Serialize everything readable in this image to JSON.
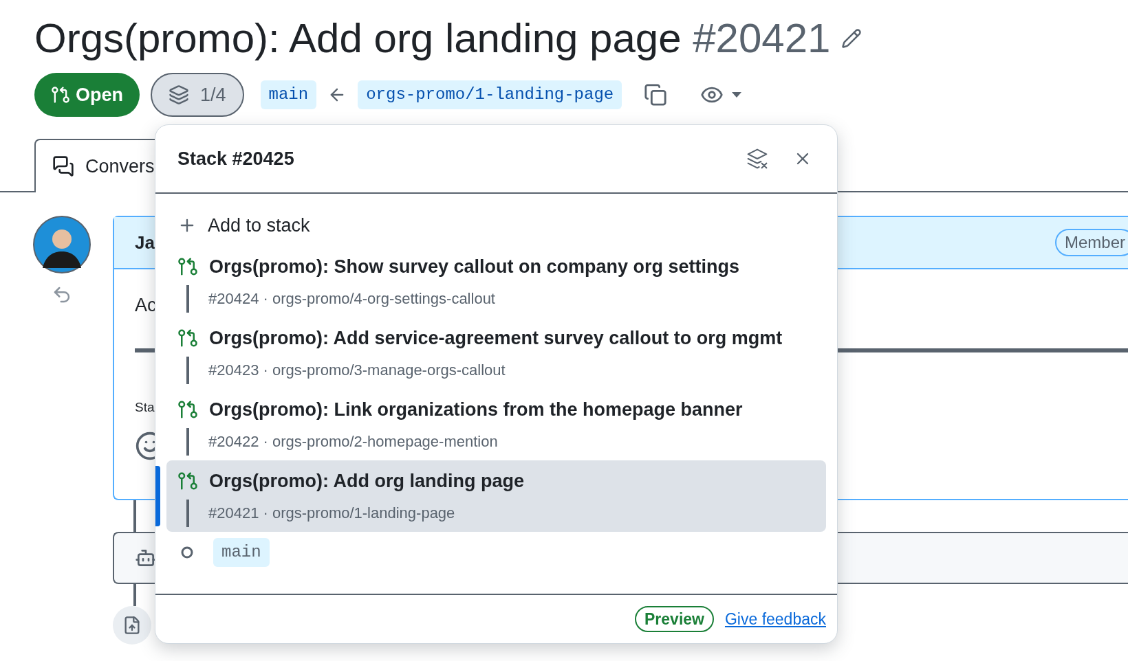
{
  "title": "Orgs(promo): Add org landing page",
  "number": "#20421",
  "state_badge": {
    "label": "Open"
  },
  "stack_button": "1/4",
  "base_branch": "main",
  "head_branch": "orgs-promo/1-landing-page",
  "tab": {
    "label": "Convers",
    "selected": true
  },
  "comment": {
    "author": "Ja",
    "badge": "Member",
    "body": "Ac",
    "status": "Sta"
  },
  "stack_popover": {
    "title": "Stack #20425",
    "add_label": "Add to stack",
    "items": [
      {
        "title": "Orgs(promo): Show survey callout on company org settings",
        "meta": "#20424 · orgs-promo/4-org-settings-callout",
        "selected": false
      },
      {
        "title": "Orgs(promo): Add service-agreement survey callout to org mgmt",
        "meta": "#20423 · orgs-promo/3-manage-orgs-callout",
        "selected": false
      },
      {
        "title": "Orgs(promo): Link organizations from the homepage banner",
        "meta": "#20422 · orgs-promo/2-homepage-mention",
        "selected": false
      },
      {
        "title": "Orgs(promo): Add org landing page",
        "meta": "#20421 · orgs-promo/1-landing-page",
        "selected": true
      }
    ],
    "base": "main",
    "preview_label": "Preview",
    "feedback_link": "Give feedback"
  }
}
